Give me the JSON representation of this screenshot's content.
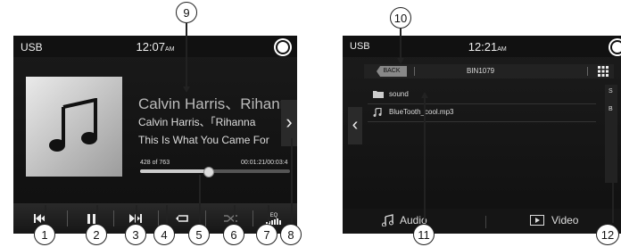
{
  "player": {
    "source": "USB",
    "time": "12:07",
    "ampm": "AM",
    "title": "Calvin Harris、Rihann...",
    "artist": "Calvin Harris、「Rihanna",
    "song": "This Is What You Came For",
    "track_counter": "428 of 763",
    "elapsed": "00:01:21/00:03:4",
    "progress": 0.45,
    "eq_label": "EQ"
  },
  "browser": {
    "source": "USB",
    "time": "12:21",
    "ampm": "AM",
    "back_label": "BACK",
    "folder_name": "BIN1079",
    "items": [
      {
        "type": "folder",
        "name": "sound"
      },
      {
        "type": "file",
        "name": "BlueTooth_cool.mp3"
      }
    ],
    "alpha_letters": [
      "S",
      "B"
    ],
    "tabs": [
      {
        "label": "Audio",
        "icon": "music-note-icon"
      },
      {
        "label": "Video",
        "icon": "video-icon"
      }
    ]
  },
  "callouts": [
    "1",
    "2",
    "3",
    "4",
    "5",
    "6",
    "7",
    "8",
    "9",
    "10",
    "11",
    "12"
  ]
}
